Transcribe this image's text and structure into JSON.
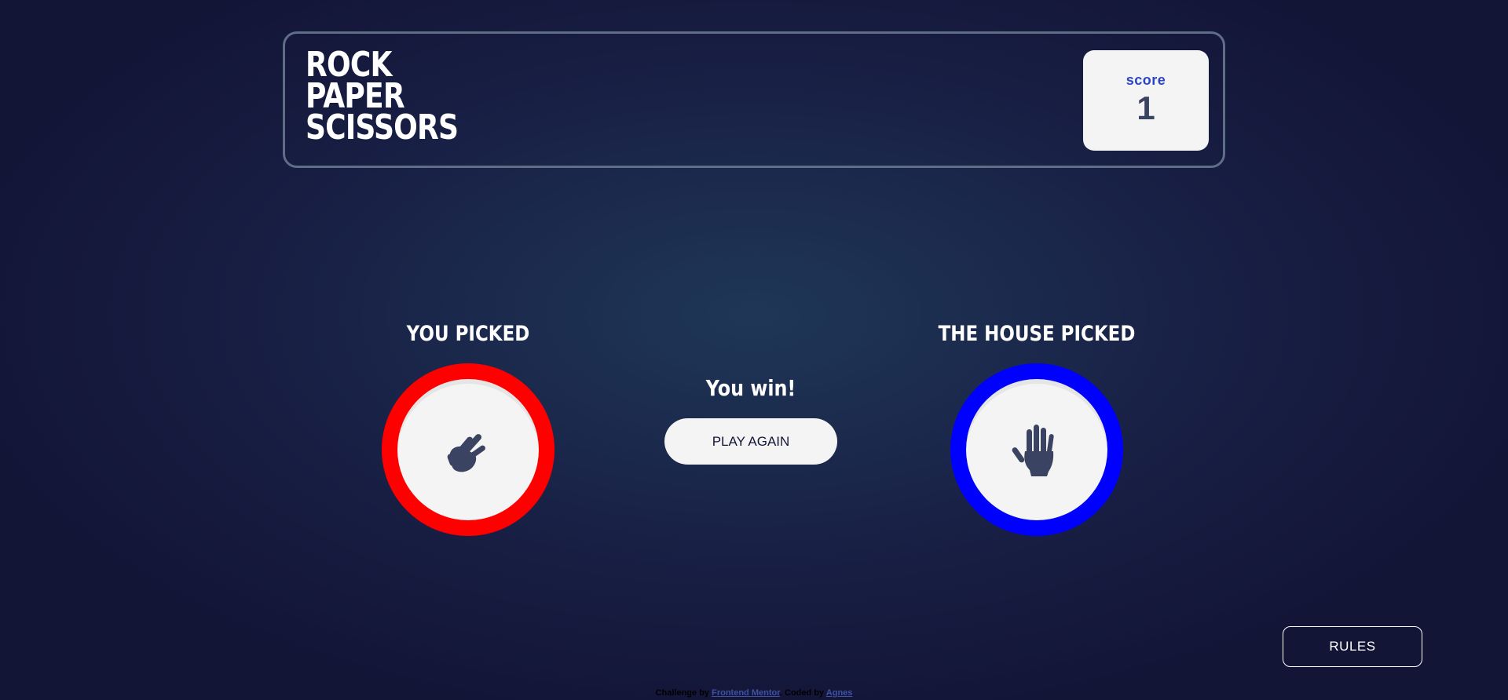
{
  "header": {
    "title_lines": [
      "ROCK",
      "PAPER",
      "SCISSORS"
    ],
    "score_label": "score",
    "score_value": "1"
  },
  "game": {
    "you_picked_label": "YOU PICKED",
    "house_picked_label": "THE HOUSE PICKED",
    "you_choice": {
      "name": "scissors",
      "icon": "scissors-icon",
      "ring_color": "#ff0000"
    },
    "house_choice": {
      "name": "paper",
      "icon": "paper-icon",
      "ring_color": "#0000ff"
    },
    "result_text": "You win!",
    "play_again_label": "PLAY AGAIN"
  },
  "rules_label": "RULES",
  "attribution": {
    "prefix": "Challenge by",
    "link1": "Frontend Mentor",
    "middle": ". Coded by",
    "link2": "Agnes"
  }
}
